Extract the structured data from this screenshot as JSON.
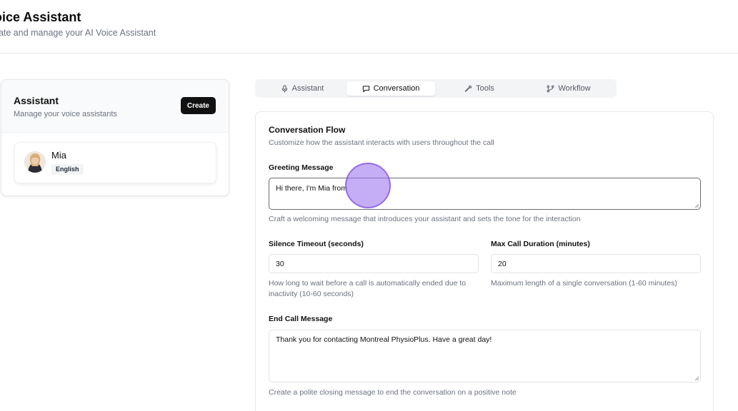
{
  "header": {
    "title": "oice Assistant",
    "subtitle": "eate and manage your AI Voice Assistant"
  },
  "assistants_panel": {
    "title": "Assistant",
    "subtitle": "Manage your voice assistants",
    "create_label": "Create",
    "items": [
      {
        "name": "Mia",
        "language": "English",
        "icon": "avatar-photo"
      }
    ]
  },
  "tabs": [
    {
      "label": "Assistant",
      "icon": "microphone-icon",
      "active": false
    },
    {
      "label": "Conversation",
      "icon": "chat-bubble-icon",
      "active": true
    },
    {
      "label": "Tools",
      "icon": "wrench-icon",
      "active": false
    },
    {
      "label": "Workflow",
      "icon": "workflow-icon",
      "active": false
    }
  ],
  "conversation_flow": {
    "title": "Conversation Flow",
    "subtitle": "Customize how the assistant interacts with users throughout the call",
    "greeting": {
      "label": "Greeting Message",
      "value": "Hi there, I'm Mia from",
      "help": "Craft a welcoming message that introduces your assistant and sets the tone for the interaction"
    },
    "silence_timeout": {
      "label": "Silence Timeout (seconds)",
      "value": "30",
      "help": "How long to wait before a call is automatically ended due to inactivity (10-60 seconds)"
    },
    "max_duration": {
      "label": "Max Call Duration (minutes)",
      "value": "20",
      "help": "Maximum length of a single conversation (1-60 minutes)"
    },
    "end_message": {
      "label": "End Call Message",
      "value": "Thank you for contacting Montreal PhysioPlus. Have a great day!",
      "help": "Create a polite closing message to end the conversation on a positive note"
    }
  },
  "colors": {
    "primary_button": "#111111",
    "cursor_highlight": "#a078f0",
    "muted_text": "#6b7280"
  }
}
